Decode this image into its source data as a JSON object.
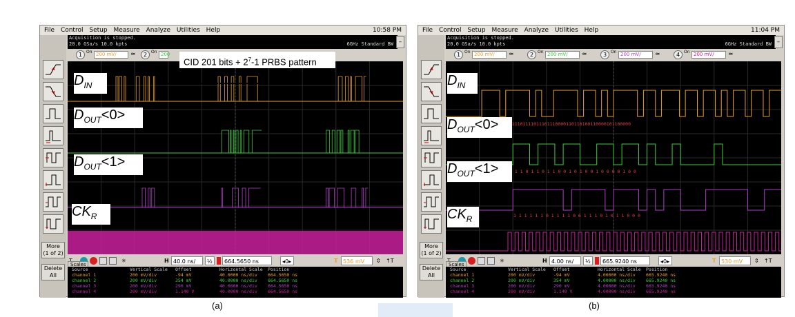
{
  "menu": [
    "File",
    "Control",
    "Setup",
    "Measure",
    "Analyze",
    "Utilities",
    "Help"
  ],
  "left_buttons": {
    "more": "More",
    "more_sub": "(1 of 2)",
    "delete": "Delete",
    "delete_sub": "All"
  },
  "panels": [
    {
      "clock": "10:58 PM",
      "status_line1": "Acquisition is stopped.",
      "status_line2": "20.0 GSa/s   10.0 kpts",
      "bandwidth": "6GHz Standard BW",
      "channels": [
        {
          "num": "1",
          "on": "On",
          "scale": "200 mV/"
        },
        {
          "num": "2",
          "on": "On",
          "scale": "200"
        }
      ],
      "annotation": "CID 201 bits + 2",
      "annotation_sup": "7",
      "annotation_rest": "-1 PRBS pattern",
      "labels": {
        "din": "D",
        "din_sub": "IN",
        "dout0": "D",
        "dout0_sub": "OUT",
        "dout0_suffix": "<0>",
        "dout1": "D",
        "dout1_sub": "OUT",
        "dout1_suffix": "<1>",
        "ckr": "CK",
        "ckr_sub": "R"
      },
      "timebase": "40.0 ns/",
      "position": "664.5650 ns",
      "trigger": "536 mV",
      "scales_headers": [
        "Source",
        "Vertical Scale",
        "Offset",
        "Horizontal Scale",
        "Position"
      ],
      "scales_rows": [
        [
          "channel 1",
          "200 mV/div",
          "-94 mV",
          "40.0000 ns/div",
          "664.5650 ns"
        ],
        [
          "channel 2",
          "200 mV/div",
          "354 mV",
          "40.0000 ns/div",
          "664.5650 ns"
        ],
        [
          "channel 3",
          "200 mV/div",
          "290 mV",
          "40.0000 ns/div",
          "664.5650 ns"
        ],
        [
          "channel 4",
          "200 mV/div",
          "1.140 V",
          "40.0000 ns/div",
          "664.5650 ns"
        ]
      ],
      "caption": "(a)"
    },
    {
      "clock": "11:04 PM",
      "status_line1": "Acquisition is stopped.",
      "status_line2": "20.0 GSa/s   10.0 kpts",
      "bandwidth": "6GHz Standard BW",
      "channels": [
        {
          "num": "1",
          "on": "On",
          "scale": "200 mV/"
        },
        {
          "num": "2",
          "on": "On",
          "scale": "200 mV/"
        },
        {
          "num": "3",
          "on": "On",
          "scale": "200 mV/"
        },
        {
          "num": "4",
          "on": "On",
          "scale": "200 mV/"
        }
      ],
      "labels": {
        "din": "D",
        "din_sub": "IN",
        "dout0": "D",
        "dout0_sub": "OUT",
        "dout0_suffix": "<0>",
        "dout1": "D",
        "dout1_sub": "OUT",
        "dout1_suffix": "<1>",
        "ckr": "CK",
        "ckr_sub": "R"
      },
      "bits_din": "0111101111011101110000110110100110000101100000",
      "bits_dout0": "0 1 1 0 1 1 0 1 1 0 0 1 0 1 0 0 1 0 0 0 0 1 0 0",
      "bits_dout1": "1 1 1 1 1 1 0 1 1 1 1 0 6 1 1 1 0 1 0 1 1 0 0 0",
      "timebase": "4.00 ns/",
      "position": "665.9240 ns",
      "trigger": "530 mV",
      "scales_headers": [
        "Source",
        "Vertical Scale",
        "Offset",
        "Horizontal Scale",
        "Position"
      ],
      "scales_rows": [
        [
          "channel 1",
          "200 mV/div",
          "-94 mV",
          "4.00000 ns/div",
          "665.9240 ns"
        ],
        [
          "channel 2",
          "200 mV/div",
          "354 mV",
          "4.00000 ns/div",
          "665.9240 ns"
        ],
        [
          "channel 3",
          "200 mV/div",
          "290 mV",
          "4.00000 ns/div",
          "665.9240 ns"
        ],
        [
          "channel 4",
          "200 mV/div",
          "1.140 V",
          "4.00000 ns/div",
          "665.9240 ns"
        ]
      ],
      "caption": "(b)"
    }
  ],
  "scales_tab": "Scales",
  "trace_colors": {
    "ch1": "#e8a030",
    "ch2": "#3ccf3c",
    "ch3": "#b040c8",
    "ch4": "#c8209c"
  }
}
